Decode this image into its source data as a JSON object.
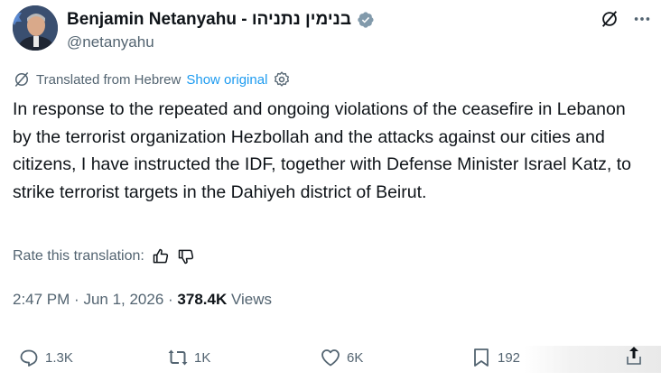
{
  "author": {
    "display_name": "Benjamin Netanyahu - בנימין נתניהו",
    "handle": "@netanyahu"
  },
  "translation": {
    "label": "Translated from Hebrew",
    "show_original": "Show original"
  },
  "tweet": {
    "text": "In response to the repeated and ongoing violations of the ceasefire in Lebanon by the terrorist organization Hezbollah and the attacks against our cities and citizens, I have instructed the IDF, together with Defense Minister Israel Katz, to strike terrorist targets in the Dahiyeh district of Beirut."
  },
  "rate": {
    "label": "Rate this translation:"
  },
  "meta": {
    "time": "2:47 PM",
    "date": "Jun 1, 2026",
    "views_count": "378.4K",
    "views_label": "Views"
  },
  "actions": {
    "replies": "1.3K",
    "reposts": "1K",
    "likes": "6K",
    "bookmarks": "192"
  },
  "colors": {
    "text": "#0f1419",
    "secondary": "#536471",
    "link": "#1d9bf0",
    "verified": "#829aab"
  },
  "icons": [
    "verified-badge-icon",
    "grok-icon",
    "more-icon",
    "translate-icon",
    "gear-icon",
    "thumbs-up-icon",
    "thumbs-down-icon",
    "reply-icon",
    "repost-icon",
    "like-icon",
    "bookmark-icon",
    "share-icon"
  ]
}
